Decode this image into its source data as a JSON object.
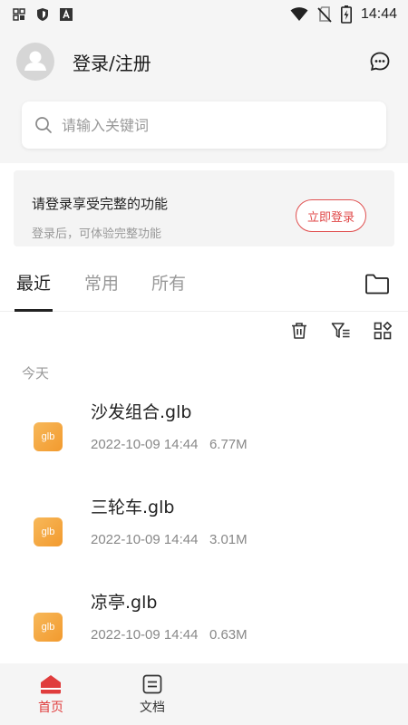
{
  "status_bar": {
    "time": "14:44",
    "left_icons": [
      "app-grid-icon",
      "shield-icon",
      "font-a-icon"
    ],
    "right_icons": [
      "wifi-icon",
      "no-sim-icon",
      "battery-charging-icon"
    ]
  },
  "header": {
    "login_title": "登录/注册",
    "message_icon": "chat-bubble-icon"
  },
  "search": {
    "placeholder": "请输入关键词"
  },
  "banner": {
    "title": "请登录享受完整的功能",
    "subtitle": "登录后，可体验完整功能",
    "button_label": "立即登录"
  },
  "tabs": [
    {
      "label": "最近",
      "active": true
    },
    {
      "label": "常用",
      "active": false
    },
    {
      "label": "所有",
      "active": false
    }
  ],
  "toolbar": {
    "icons": [
      "trash-icon",
      "filter-list-icon",
      "grid-view-icon"
    ]
  },
  "section": {
    "label": "今天"
  },
  "files": [
    {
      "icon_text": "glb",
      "name": "沙发组合.glb",
      "date": "2022-10-09 14:44",
      "size": "6.77M"
    },
    {
      "icon_text": "glb",
      "name": "三轮车.glb",
      "date": "2022-10-09 14:44",
      "size": "3.01M"
    },
    {
      "icon_text": "glb",
      "name": "凉亭.glb",
      "date": "2022-10-09 14:44",
      "size": "0.63M"
    }
  ],
  "bottom_nav": [
    {
      "label": "首页",
      "icon": "home-icon",
      "active": true
    },
    {
      "label": "文档",
      "icon": "document-icon",
      "active": false
    }
  ],
  "colors": {
    "accent": "#e03c3c",
    "file_icon": "#f4a640",
    "muted_text": "#999999"
  }
}
